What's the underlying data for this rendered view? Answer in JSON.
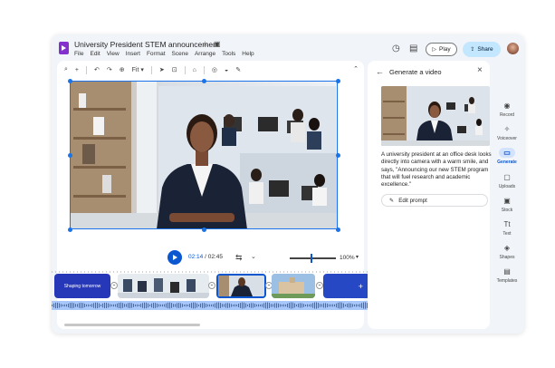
{
  "header": {
    "doc_title": "University President STEM announcement",
    "star_icon": "star-icon",
    "folder_icon": "folder-move-icon",
    "menu": [
      "File",
      "Edit",
      "View",
      "Insert",
      "Format",
      "Scene",
      "Arrange",
      "Tools",
      "Help"
    ],
    "play_label": "Play",
    "share_label": "Share"
  },
  "toolbar": {
    "zoom_label": "Fit"
  },
  "playback": {
    "current_time": "02:14",
    "total_time": "02:45",
    "time_separator": " / ",
    "zoom_percent": "100%",
    "zoom_fraction": 0.45
  },
  "timeline": {
    "title_clip_text": "Shaping tomorrow"
  },
  "generate_panel": {
    "title": "Generate a video",
    "description": "A university president at an office desk looks directly into camera with a warm smile, and says, \"Announcing our new STEM program that will fuel research and academic excellence.\"",
    "edit_prompt_label": "Edit prompt"
  },
  "rail": [
    {
      "label": "Record",
      "icon": "record-icon",
      "active": false
    },
    {
      "label": "Voiceover",
      "icon": "voiceover-icon",
      "active": false
    },
    {
      "label": "Generate",
      "icon": "generate-icon",
      "active": true
    },
    {
      "label": "Uploads",
      "icon": "uploads-icon",
      "active": false
    },
    {
      "label": "Stock",
      "icon": "stock-icon",
      "active": false
    },
    {
      "label": "Text",
      "icon": "text-icon",
      "active": false
    },
    {
      "label": "Shapes",
      "icon": "shapes-icon",
      "active": false
    },
    {
      "label": "Templates",
      "icon": "templates-icon",
      "active": false
    }
  ],
  "colors": {
    "accent": "#0b57d0",
    "share_bg": "#c2e7ff",
    "app_icon": "#8430ce",
    "clip_blue": "#2638b8",
    "audio": "#1a73e8",
    "background": "#f1f4f9"
  }
}
